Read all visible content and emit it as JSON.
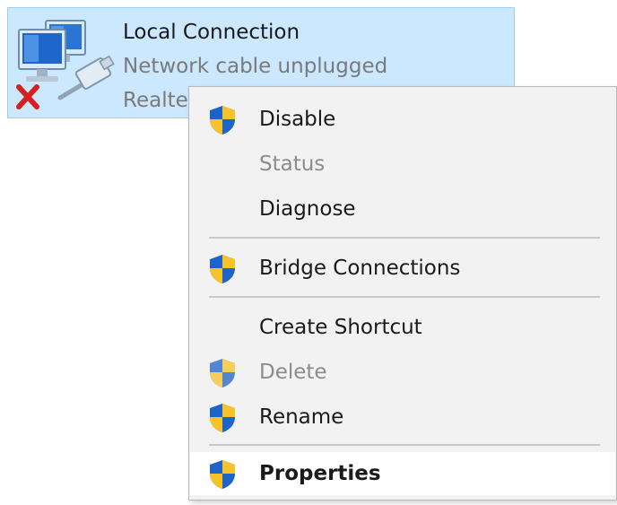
{
  "connection": {
    "name": "Local Connection",
    "status": "Network cable unplugged",
    "device": "Realtek PCIe GBE Family Controller",
    "icon": "network-disconnected-icon"
  },
  "menu": {
    "disable": {
      "label": "Disable",
      "icon": "uac-shield-icon"
    },
    "status": {
      "label": "Status"
    },
    "diagnose": {
      "label": "Diagnose"
    },
    "bridge": {
      "label": "Bridge Connections",
      "icon": "uac-shield-icon"
    },
    "shortcut": {
      "label": "Create Shortcut"
    },
    "delete": {
      "label": "Delete",
      "icon": "uac-shield-icon"
    },
    "rename": {
      "label": "Rename",
      "icon": "uac-shield-icon"
    },
    "properties": {
      "label": "Properties",
      "icon": "uac-shield-icon"
    }
  },
  "colors": {
    "selection_bg": "#cce8ff",
    "menu_bg": "#f2f2f2",
    "disabled_text": "#8c8c8c",
    "shield_blue": "#1e63c8",
    "shield_yellow": "#f6c32a"
  }
}
